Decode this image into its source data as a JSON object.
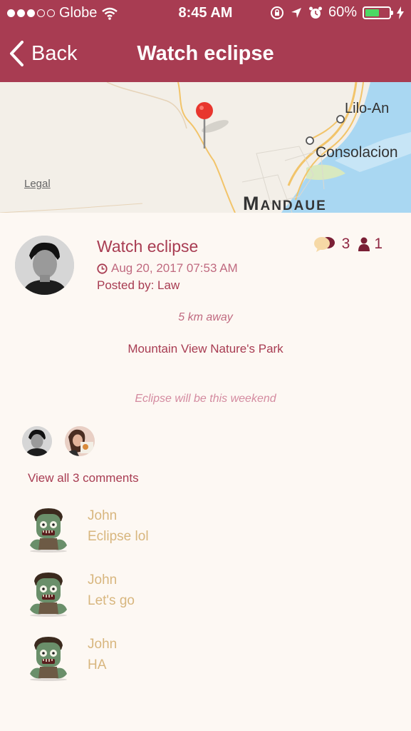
{
  "status_bar": {
    "carrier": "Globe",
    "time": "8:45 AM",
    "battery": "60%",
    "battery_level": 0.6,
    "battery_color": "#4cd964"
  },
  "nav": {
    "back_label": "Back",
    "title": "Watch eclipse",
    "bar_color": "#a83c52"
  },
  "map": {
    "legal": "Legal",
    "labels": {
      "liloan": "Lilo-An",
      "consolacion": "Consolacion",
      "mandaue": "Mandaue"
    }
  },
  "event": {
    "title": "Watch eclipse",
    "date": "Aug 20, 2017 07:53 AM",
    "posted_by": "Posted by: Law",
    "comment_count": "3",
    "attendee_count": "1",
    "distance": "5 km away",
    "location": "Mountain View Nature's Park",
    "description": "Eclipse will be this weekend"
  },
  "comments_section": {
    "view_all": "View all 3 comments",
    "items": [
      {
        "author": "John",
        "text": "Eclipse lol"
      },
      {
        "author": "John",
        "text": "Let's go"
      },
      {
        "author": "John",
        "text": "HA"
      }
    ]
  },
  "icons": {
    "back": "chevron-left-icon",
    "wifi": "wifi-icon",
    "orientation_lock": "orientation-lock-icon",
    "location": "location-arrow-icon",
    "alarm": "alarm-icon",
    "charging": "charging-icon",
    "map_pin": "map-pin-icon",
    "clock": "clock-icon",
    "chat": "chat-bubbles-icon",
    "person": "person-icon"
  }
}
